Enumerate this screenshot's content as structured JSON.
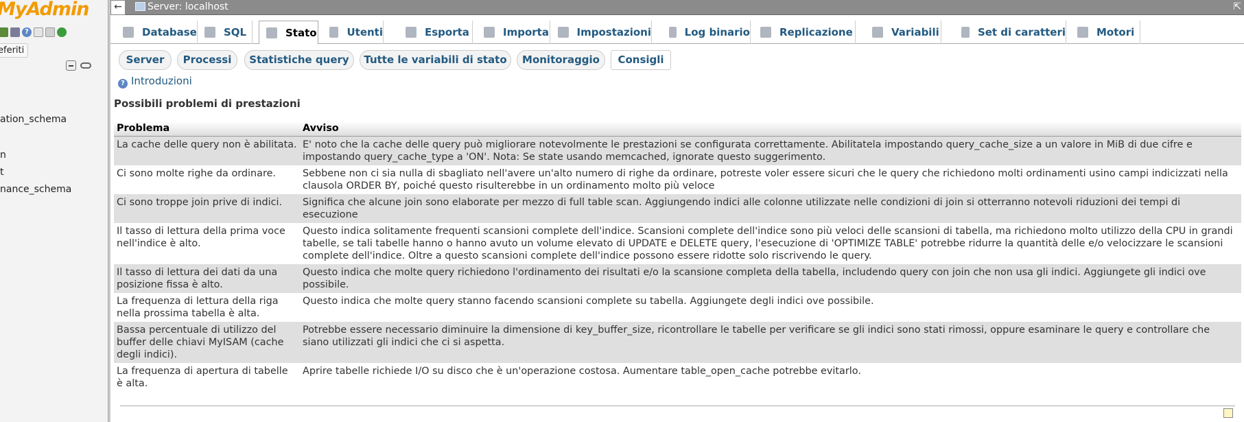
{
  "nav": {
    "logo_text": "MyAdmin",
    "favorites_label": "eferiti",
    "databases": [
      "ation_schema",
      "n",
      "t",
      "nance_schema"
    ]
  },
  "topbar": {
    "back_label": "←",
    "server_title": "Server: localhost",
    "collapse_label": "⇱"
  },
  "menu": {
    "tabs": [
      {
        "label": "Database",
        "icon": "database-icon"
      },
      {
        "label": "SQL",
        "icon": "sql-icon"
      },
      {
        "label": "Stato",
        "icon": "status-icon"
      },
      {
        "label": "Utenti",
        "icon": "users-icon"
      },
      {
        "label": "Esporta",
        "icon": "export-icon"
      },
      {
        "label": "Importa",
        "icon": "import-icon"
      },
      {
        "label": "Impostazioni",
        "icon": "wrench-icon"
      },
      {
        "label": "Log binario",
        "icon": "binlog-icon"
      },
      {
        "label": "Replicazione",
        "icon": "replication-icon"
      },
      {
        "label": "Variabili",
        "icon": "variables-icon"
      },
      {
        "label": "Set di caratteri",
        "icon": "charset-icon"
      },
      {
        "label": "Motori",
        "icon": "engines-icon"
      }
    ],
    "active": "Stato"
  },
  "subtabs": {
    "items": [
      "Server",
      "Processi",
      "Statistiche query",
      "Tutte le variabili di stato",
      "Monitoraggio",
      "Consigli"
    ],
    "active": "Consigli"
  },
  "content": {
    "intro_link": "Introduzioni",
    "section_title": "Possibili problemi di prestazioni",
    "columns": [
      "Problema",
      "Avviso"
    ],
    "rows": [
      {
        "problem": "La cache delle query non è abilitata.",
        "advice": "E' noto che la cache delle query può migliorare notevolmente le prestazioni se configurata correttamente. Abilitatela impostando query_cache_size a un valore in MiB di due cifre e impostando query_cache_type a 'ON'. Nota: Se state usando memcached, ignorate questo suggerimento."
      },
      {
        "problem": "Ci sono molte righe da ordinare.",
        "advice": "Sebbene non ci sia nulla di sbagliato nell'avere un'alto numero di righe da ordinare, potreste voler essere sicuri che le query che richiedono molti ordinamenti usino campi indicizzati nella clausola ORDER BY, poiché questo risulterebbe in un ordinamento molto più veloce"
      },
      {
        "problem": "Ci sono troppe join prive di indici.",
        "advice": "Significa che alcune join sono elaborate per mezzo di full table scan. Aggiungendo indici alle colonne utilizzate nelle condizioni di join si otterranno notevoli riduzioni dei tempi di esecuzione"
      },
      {
        "problem": "Il tasso di lettura della prima voce nell'indice è alto.",
        "advice": "Questo indica solitamente frequenti scansioni complete dell'indice. Scansioni complete dell'indice sono più veloci delle scansioni di tabella, ma richiedono molto utilizzo della CPU in grandi tabelle, se tali tabelle hanno o hanno avuto un volume elevato di UPDATE e DELETE query, l'esecuzione di 'OPTIMIZE TABLE' potrebbe ridurre la quantità delle e/o velocizzare le scansioni complete dell'indice. Oltre a questo scansioni complete dell'indice possono essere ridotte solo riscrivendo le query."
      },
      {
        "problem": "Il tasso di lettura dei dati da una posizione fissa è alto.",
        "advice": "Questo indica che molte query richiedono l'ordinamento dei risultati e/o la scansione completa della tabella, includendo query con join che non usa gli indici. Aggiungete gli indici ove possibile."
      },
      {
        "problem": "La frequenza di lettura della riga nella prossima tabella è alta.",
        "advice": "Questo indica che molte query stanno facendo scansioni complete su tabella. Aggiungete degli indici ove possibile."
      },
      {
        "problem": "Bassa percentuale di utilizzo del buffer delle chiavi MyISAM (cache degli indici).",
        "advice": "Potrebbe essere necessario diminuire la dimensione di key_buffer_size, ricontrollare le tabelle per verificare se gli indici sono stati rimossi, oppure esaminare le query e controllare che siano utilizzati gli indici che ci si aspetta."
      },
      {
        "problem": "La frequenza di apertura di tabelle è alta.",
        "advice": "Aprire tabelle richiede I/O su disco che è un'operazione costosa. Aumentare table_open_cache potrebbe evitarlo."
      }
    ]
  }
}
